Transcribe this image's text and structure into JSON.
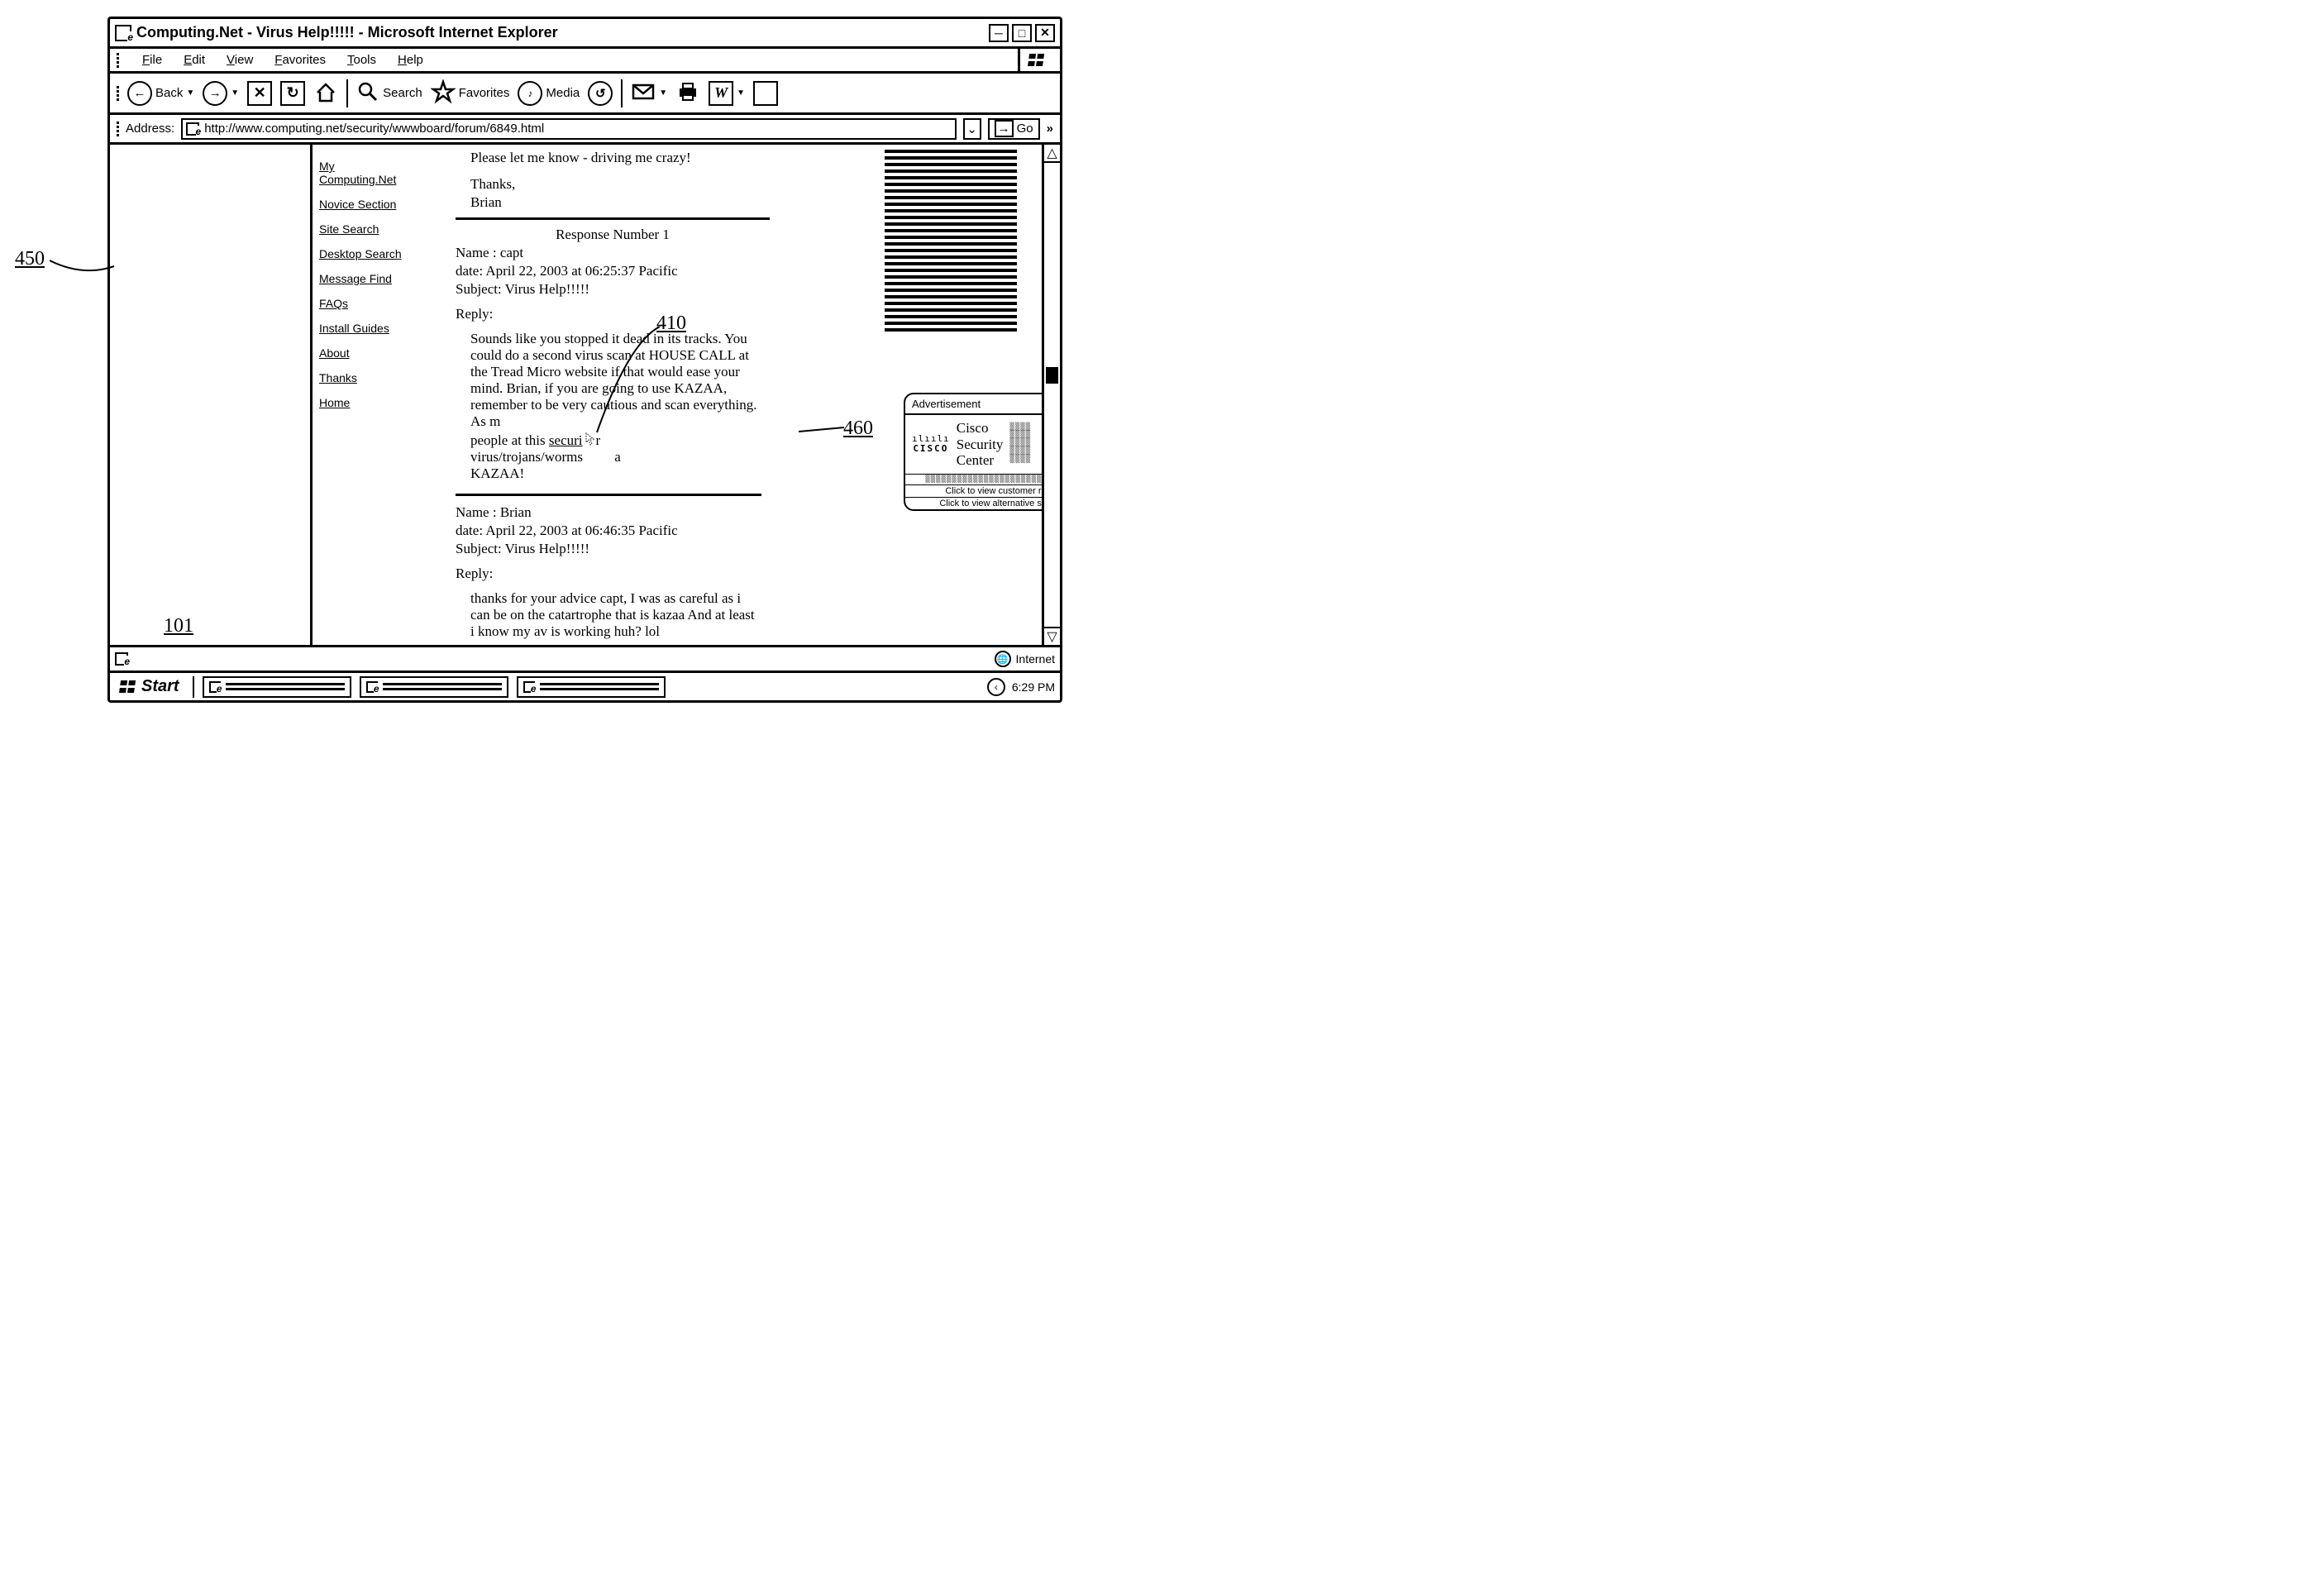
{
  "callouts": {
    "c450": "450",
    "c410": "410",
    "c460": "460",
    "c101": "101"
  },
  "window": {
    "title": "Computing.Net - Virus Help!!!!! - Microsoft Internet Explorer"
  },
  "menu": {
    "file": "File",
    "edit": "Edit",
    "view": "View",
    "favorites": "Favorites",
    "tools": "Tools",
    "help": "Help"
  },
  "toolbar": {
    "back": "Back",
    "search": "Search",
    "favorites": "Favorites",
    "media": "Media"
  },
  "address": {
    "label": "Address:",
    "url": "http://www.computing.net/security/wwwboard/forum/6849.html",
    "go": "Go"
  },
  "nav": {
    "my": "My Computing.Net",
    "novice": "Novice Section",
    "sitesearch": "Site Search",
    "desktop": "Desktop Search",
    "msgfind": "Message Find",
    "faqs": "FAQs",
    "install": "Install Guides",
    "about": "About",
    "thanks": "Thanks",
    "home": "Home"
  },
  "thread": {
    "intro1": "Please let me know - driving me crazy!",
    "intro2": "Thanks,",
    "intro3": "Brian",
    "resp_title": "Response Number 1",
    "r1_name": "Name : capt",
    "r1_date": "date: April 22, 2003 at 06:25:37 Pacific",
    "r1_subj": "Subject: Virus Help!!!!!",
    "r1_reply_lbl": "Reply:",
    "r1_body_a": "Sounds like you stopped it dead in its tracks. You could do a second virus scan at HOUSE CALL at the Tread Micro website if that would ease your mind. Brian, if you are going to use KAZAA, remember to be very cautious and scan everything. As m",
    "r1_body_b": "people at this ",
    "r1_body_link": "securi",
    "r1_body_c": "r",
    "r1_body_d": "virus/trojans/worms ",
    "r1_body_e": "a",
    "r1_body_f": "KAZAA!",
    "r2_name": "Name : Brian",
    "r2_date": "date: April 22, 2003 at 06:46:35 Pacific",
    "r2_subj": "Subject: Virus Help!!!!!",
    "r2_reply_lbl": "Reply:",
    "r2_body": "thanks for your advice capt, I was as careful as i can be on the catartrophe that is kazaa And at least i know my av is working huh? lol"
  },
  "popup": {
    "title": "Advertisement",
    "brand_bars": "ılıılı",
    "brand_name": "CISCO",
    "line1": "Cisco",
    "line2": "Security",
    "line3": "Center",
    "link1": "Click to view customer review",
    "link2": "Click to view alternative services"
  },
  "status": {
    "zone": "Internet"
  },
  "taskbar": {
    "start": "Start",
    "time": "6:29 PM"
  }
}
